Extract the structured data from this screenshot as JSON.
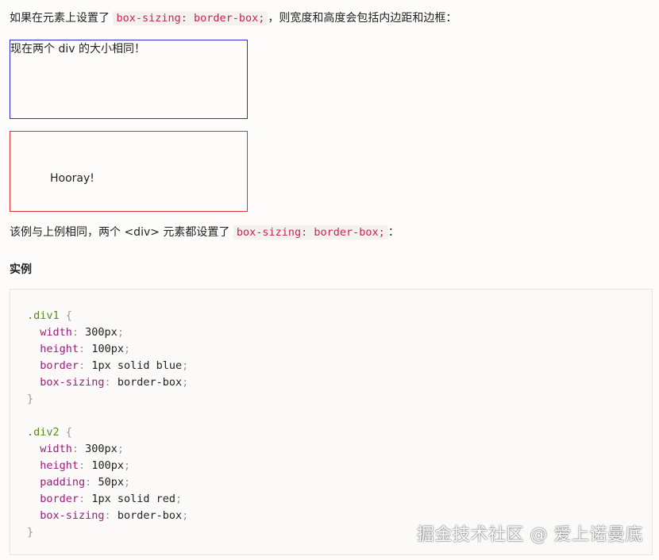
{
  "intro": {
    "before": "如果在元素上设置了 ",
    "code": "box-sizing: border-box;",
    "after": "，则宽度和高度会包括内边距和边框："
  },
  "demo": {
    "div1_text": "现在两个 div 的大小相同！",
    "div2_text": "Hooray!"
  },
  "note": {
    "before": "该例与上例相同，两个 <div> 元素都设置了 ",
    "code": "box-sizing: border-box;",
    "after": "："
  },
  "example_heading": "实例",
  "code": {
    "rule1": {
      "selector": ".div1",
      "decls": [
        {
          "prop": "width",
          "value": "300px"
        },
        {
          "prop": "height",
          "value": "100px"
        },
        {
          "prop": "border",
          "value": "1px solid blue"
        },
        {
          "prop": "box-sizing",
          "value": "border-box"
        }
      ]
    },
    "rule2": {
      "selector": ".div2",
      "decls": [
        {
          "prop": "width",
          "value": "300px"
        },
        {
          "prop": "height",
          "value": "100px"
        },
        {
          "prop": "padding",
          "value": "50px"
        },
        {
          "prop": "border",
          "value": "1px solid red"
        },
        {
          "prop": "box-sizing",
          "value": "border-box"
        }
      ]
    }
  },
  "watermark": "掘金技术社区 @ 爱上诺曼底",
  "colors": {
    "inline_code": "#c7254e",
    "selector": "#5a8a1a",
    "property": "#9a1f78",
    "div1_border": "#2b2bd8",
    "div2_border": "#e03030"
  }
}
